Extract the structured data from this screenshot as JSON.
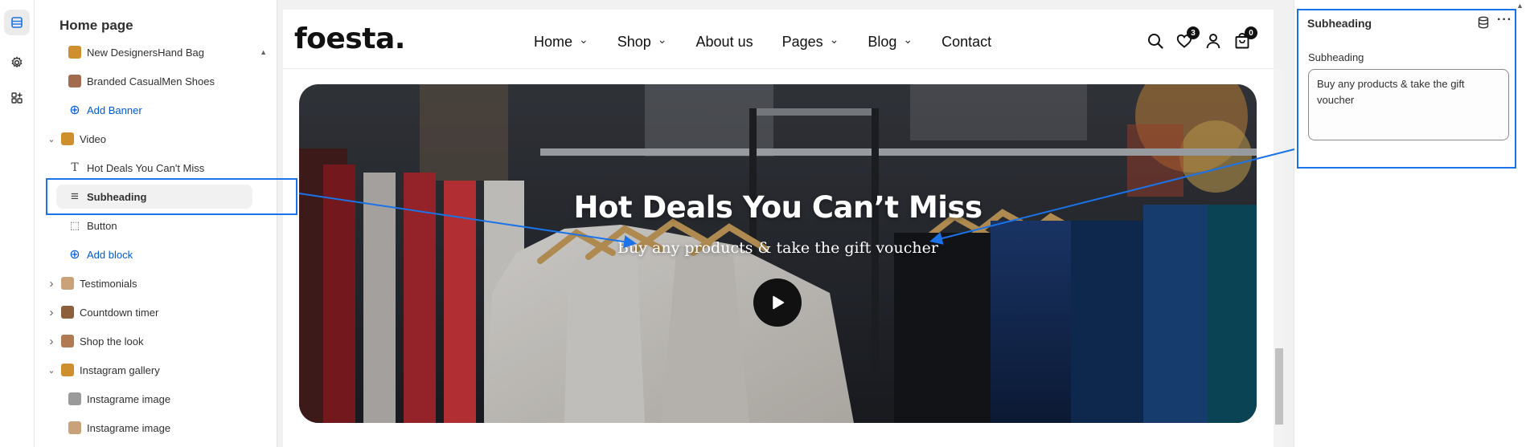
{
  "sidebar": {
    "title": "Home page",
    "items": [
      {
        "label": "New DesignersHand Bag",
        "kind": "image",
        "indent": 2
      },
      {
        "label": "Branded CasualMen Shoes",
        "kind": "image",
        "indent": 2
      },
      {
        "label": "Add Banner",
        "kind": "add",
        "indent": 2
      },
      {
        "label": "Video",
        "kind": "section",
        "indent": 1,
        "expanded": true
      },
      {
        "label": "Hot Deals You Can't Miss",
        "kind": "text",
        "indent": 2
      },
      {
        "label": "Subheading",
        "kind": "lines",
        "indent": 2,
        "selected": true
      },
      {
        "label": "Button",
        "kind": "button",
        "indent": 2
      },
      {
        "label": "Add block",
        "kind": "add",
        "indent": 2
      },
      {
        "label": "Testimonials",
        "kind": "section",
        "indent": 1,
        "expanded": false
      },
      {
        "label": "Countdown timer",
        "kind": "section",
        "indent": 1,
        "expanded": false
      },
      {
        "label": "Shop the look",
        "kind": "section",
        "indent": 1,
        "expanded": false
      },
      {
        "label": "Instagram gallery",
        "kind": "section",
        "indent": 1,
        "expanded": true
      },
      {
        "label": "Instagrame image",
        "kind": "image",
        "indent": 2
      },
      {
        "label": "Instagrame image",
        "kind": "image",
        "indent": 2
      }
    ]
  },
  "store": {
    "logo": "foesta.",
    "nav": [
      {
        "label": "Home",
        "dropdown": true
      },
      {
        "label": "Shop",
        "dropdown": true
      },
      {
        "label": "About us",
        "dropdown": false
      },
      {
        "label": "Pages",
        "dropdown": true
      },
      {
        "label": "Blog",
        "dropdown": true
      },
      {
        "label": "Contact",
        "dropdown": false
      }
    ],
    "wishlist_count": "3",
    "cart_count": "0",
    "icons": [
      "search-icon",
      "heart-icon",
      "user-icon",
      "bag-icon"
    ]
  },
  "hero": {
    "title": "Hot Deals You Can’t Miss",
    "subheading": "Buy any products & take the gift voucher"
  },
  "panel": {
    "title": "Subheading",
    "field_label": "Subheading",
    "field_value": "Buy any products & take the gift voucher"
  },
  "colors": {
    "accent": "#005bd3",
    "highlight": "#1a73e8",
    "badge": "#111111"
  }
}
